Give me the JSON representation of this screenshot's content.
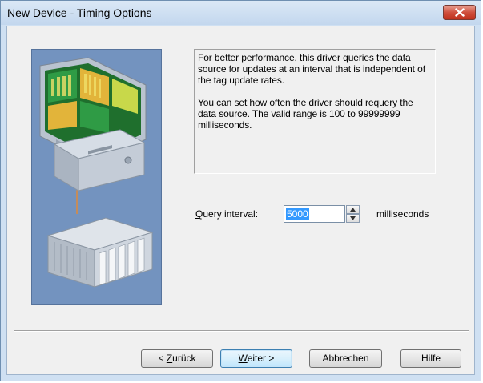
{
  "window": {
    "title": "New Device - Timing Options"
  },
  "illustration": {
    "icon": "computer-to-device-network-illustration",
    "colors": {
      "background": "#6f8fbc",
      "screen": "#2a8a3a",
      "cable": "#e07b2a"
    }
  },
  "info": {
    "text": "For better performance, this driver queries the data source for updates at an interval that is independent of the tag update rates.\n\nYou can set how often the driver should requery the data source.  The valid range is 100 to 99999999 milliseconds."
  },
  "query": {
    "label_prefix": "",
    "label_accel": "Q",
    "label_rest": "uery interval:",
    "value": "5000",
    "unit": "milliseconds"
  },
  "buttons": {
    "back": {
      "prefix": "< ",
      "accel": "Z",
      "rest": "urück"
    },
    "next": {
      "prefix": "",
      "accel": "W",
      "rest": "eiter >"
    },
    "cancel": "Abbrechen",
    "help": "Hilfe"
  }
}
